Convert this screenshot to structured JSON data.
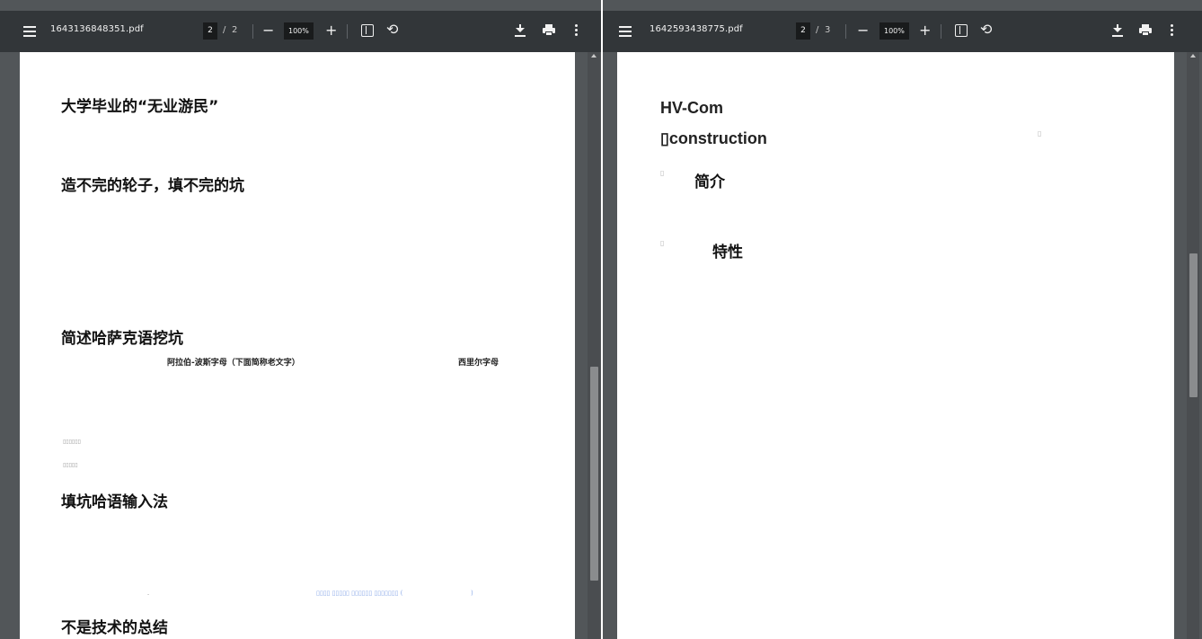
{
  "left_viewer": {
    "toolbar": {
      "menu_icon": "hamburger-menu-icon",
      "filename": "1643136848351.pdf",
      "current_page": "2",
      "page_separator": "/",
      "total_pages": "2",
      "zoom_out": "−",
      "zoom_level": "100%",
      "zoom_in": "+",
      "fit_icon": "fit-to-page-icon",
      "rotate_icon": "rotate-icon",
      "rotate_glyph": "⟲",
      "download_icon": "download-icon",
      "print_icon": "print-icon",
      "more_icon": "more-options-icon"
    },
    "page": {
      "heading_1": "大学毕业的“无业游民”",
      "heading_2": "造不完的轮子，填不完的坑",
      "heading_3": "简述哈萨克语挖坑",
      "sub_label_1": "阿拉伯-波斯字母（下面简称老文字）",
      "sub_label_2": "西里尔字母",
      "tiny_text_1": "▯▯▯▯▯▯",
      "tiny_text_2": "▯▯▯▯▯",
      "heading_4": "填坑哈语输入法",
      "link_text": "▯▯▯▯ ▯▯▯▯▯ ▯▯▯▯▯▯ ▯▯▯▯▯▯▯ (",
      "link_paren_close": ")",
      "dash_mark": "-",
      "heading_5": "不是技术的总结"
    },
    "scrollbar": {
      "position_fraction": 0.6
    }
  },
  "right_viewer": {
    "toolbar": {
      "menu_icon": "hamburger-menu-icon",
      "filename": "1642593438775.pdf",
      "current_page": "2",
      "page_separator": "/",
      "total_pages": "3",
      "zoom_out": "−",
      "zoom_level": "100%",
      "zoom_in": "+",
      "fit_icon": "fit-to-page-icon",
      "rotate_icon": "rotate-icon",
      "rotate_glyph": "⟲",
      "download_icon": "download-icon",
      "print_icon": "print-icon",
      "more_icon": "more-options-icon"
    },
    "page": {
      "title_line_1": "HV-Com",
      "title_line_2": "▯construction",
      "missing_glyph": "▯",
      "section_1": "简介",
      "section_2": "特性"
    },
    "scrollbar": {
      "position_fraction": 0.4
    }
  },
  "colors": {
    "toolbar_bg": "#323639",
    "viewer_bg": "#525659",
    "page_bg": "#ffffff",
    "link": "#8aa9e8"
  }
}
